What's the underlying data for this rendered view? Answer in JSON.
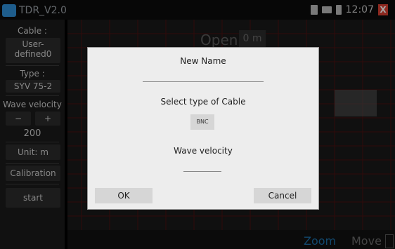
{
  "app": {
    "title": "TDR_V2.0",
    "time": "12:07",
    "close": "X"
  },
  "sidebar": {
    "cable_label": "Cable :",
    "cable_value_line1": "User-",
    "cable_value_line2": "defined0",
    "type_label": "Type :",
    "type_value": "SYV 75-2",
    "wave_velocity_label": "Wave velocity",
    "minus": "−",
    "plus": "+",
    "velocity_value": "200",
    "unit": "Unit: m",
    "calibration": "Calibration",
    "start": "start"
  },
  "plot": {
    "open_label": "Open:",
    "open_value": "0 m",
    "zoom": "Zoom",
    "move": "Move"
  },
  "dialog": {
    "title": "New Name",
    "select_label": "Select type of Cable",
    "bnc": "BNC",
    "wave_velocity_label": "Wave velocity",
    "ok": "OK",
    "cancel": "Cancel"
  },
  "colors": {
    "grid": "#4a1010",
    "accent": "#1c6fa8",
    "dialog_bg": "#ededed"
  }
}
